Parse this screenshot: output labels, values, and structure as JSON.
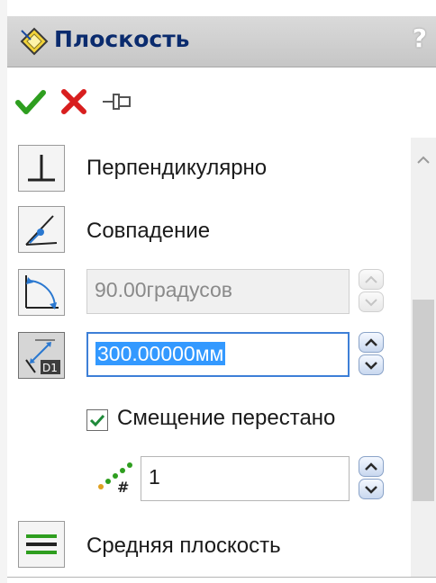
{
  "window": {
    "title": "Плоскость",
    "help_label": "?"
  },
  "toolbar": {
    "ok_icon": "checkmark-icon",
    "cancel_icon": "cross-icon",
    "pin_icon": "pushpin-icon"
  },
  "options": {
    "perpendicular": {
      "label": "Перпендикулярно",
      "icon": "perpendicular-icon"
    },
    "coincident": {
      "label": "Совпадение",
      "icon": "coincident-icon"
    },
    "angle": {
      "value": "90.00градусов",
      "icon": "angle-icon",
      "enabled": false
    },
    "distance": {
      "value": "300.00000мм",
      "icon": "offset-distance-icon",
      "active": true
    },
    "flip_offset": {
      "label": "Смещение перестано",
      "checked": true
    },
    "count": {
      "value": "1",
      "icon": "pattern-count-icon"
    },
    "mid_plane": {
      "label": "Средняя плоскость",
      "icon": "mid-plane-icon"
    }
  },
  "colors": {
    "title_text": "#0a2b6e",
    "selection": "#3399ff",
    "ok_green": "#2e9e1f",
    "cancel_red": "#d81e1e"
  }
}
